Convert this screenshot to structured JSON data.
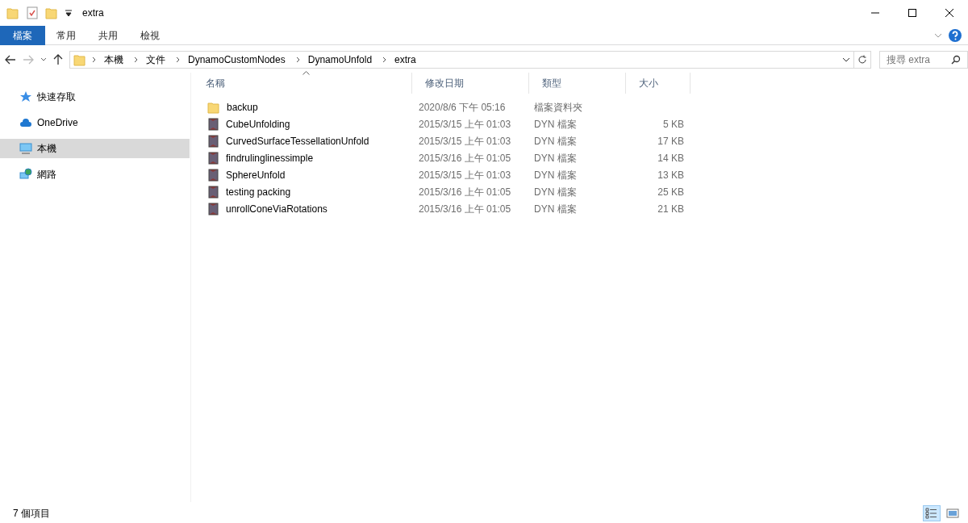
{
  "window": {
    "title": "extra"
  },
  "ribbon_tabs": [
    {
      "label": "檔案",
      "selected": true
    },
    {
      "label": "常用",
      "selected": false
    },
    {
      "label": "共用",
      "selected": false
    },
    {
      "label": "檢視",
      "selected": false
    }
  ],
  "address_bar": {
    "breadcrumbs": [
      "本機",
      "文件",
      "DynamoCustomNodes",
      "DynamoUnfold",
      "extra"
    ]
  },
  "search": {
    "placeholder": "搜尋 extra"
  },
  "sidebar": {
    "items": [
      {
        "label": "快速存取",
        "kind": "star",
        "selected": false
      },
      {
        "label": "OneDrive",
        "kind": "cloud",
        "selected": false
      },
      {
        "label": "本機",
        "kind": "computer",
        "selected": true
      },
      {
        "label": "網路",
        "kind": "network",
        "selected": false
      }
    ]
  },
  "table": {
    "columns": [
      "名稱",
      "修改日期",
      "類型",
      "大小"
    ],
    "rows": [
      {
        "kind": "folder",
        "name": "backup",
        "modified": "2020/8/6 下午 05:16",
        "type": "檔案資料夾"
      },
      {
        "kind": "file",
        "name": "CubeUnfolding",
        "modified": "2015/3/15 上午 01:03",
        "type": "DYN 檔案",
        "size": "5 KB"
      },
      {
        "kind": "file",
        "name": "CurvedSurfaceTessellationUnfold",
        "modified": "2015/3/15 上午 01:03",
        "type": "DYN 檔案",
        "size": "17 KB"
      },
      {
        "kind": "file",
        "name": "findrulinglinessimple",
        "modified": "2015/3/16 上午 01:05",
        "type": "DYN 檔案",
        "size": "14 KB"
      },
      {
        "kind": "file",
        "name": "SphereUnfold",
        "modified": "2015/3/15 上午 01:03",
        "type": "DYN 檔案",
        "size": "13 KB"
      },
      {
        "kind": "file",
        "name": "testing packing",
        "modified": "2015/3/16 上午 01:05",
        "type": "DYN 檔案",
        "size": "25 KB"
      },
      {
        "kind": "file",
        "name": "unrollConeViaRotations",
        "modified": "2015/3/16 上午 01:05",
        "type": "DYN 檔案",
        "size": "21 KB"
      }
    ]
  },
  "status_bar": {
    "item_count": "7 個項目",
    "views": [
      {
        "kind": "details",
        "selected": true
      },
      {
        "kind": "large-icons",
        "selected": false
      }
    ]
  }
}
